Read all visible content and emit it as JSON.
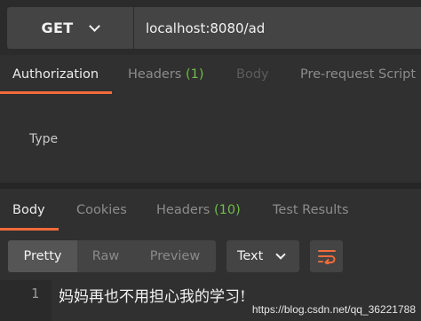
{
  "request": {
    "method": "GET",
    "url": "localhost:8080/ad"
  },
  "request_tabs": [
    {
      "label": "Authorization",
      "count": "",
      "state": "active"
    },
    {
      "label": "Headers",
      "count": "(1)",
      "state": "normal"
    },
    {
      "label": "Body",
      "count": "",
      "state": "disabled"
    },
    {
      "label": "Pre-request Script",
      "count": "",
      "state": "normal"
    }
  ],
  "authorization": {
    "type_label": "Type"
  },
  "response_tabs": [
    {
      "label": "Body",
      "count": "",
      "state": "active"
    },
    {
      "label": "Cookies",
      "count": "",
      "state": "normal"
    },
    {
      "label": "Headers",
      "count": "(10)",
      "state": "normal"
    },
    {
      "label": "Test Results",
      "count": "",
      "state": "normal"
    }
  ],
  "response_toolbar": {
    "views": [
      "Pretty",
      "Raw",
      "Preview"
    ],
    "active_view": "Pretty",
    "format": "Text",
    "wrap_icon": "wrap-lines-icon"
  },
  "response_body": {
    "lines": [
      {
        "number": "1",
        "text": "妈妈再也不用担心我的学习!"
      }
    ]
  },
  "watermark": "https://blog.csdn.net/qq_36221788",
  "colors": {
    "accent": "#f26b3a",
    "count_green": "#6fbd47",
    "background": "#303030",
    "control": "#444444"
  }
}
